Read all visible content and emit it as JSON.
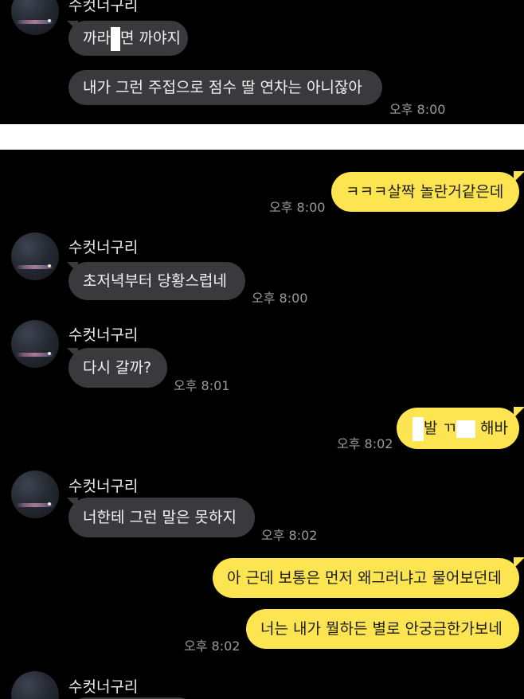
{
  "top_panel": {
    "sender": "수컷너구리",
    "msg1_part1": "까라",
    "msg1_part2": "면 까야지",
    "msg2": "내가 그런 주접으로 점수 딸 연차는 아니잖아",
    "time": "오후 8:00"
  },
  "chat": {
    "msg_out_1": "ㅋㅋㅋ살짝 놀란거같은데",
    "time_out_1": "오후 8:00",
    "sender_2": "수컷너구리",
    "msg_in_2": "초저녁부터 당황스럽네",
    "time_in_2": "오후 8:00",
    "sender_3": "수컷너구리",
    "msg_in_3": "다시 갈까?",
    "time_in_3": "오후 8:01",
    "msg_out_4_part1": "발 ㄲ",
    "msg_out_4_part2": "해바",
    "time_out_4": "오후 8:02",
    "sender_5": "수컷너구리",
    "msg_in_5": "너한테 그런 말은 못하지",
    "time_in_5": "오후 8:02",
    "msg_out_6": "아 근데 보통은 먼저 왜그러냐고 물어보던데",
    "msg_out_7": "너는 내가 뭘하든 별로 안궁금한가보네",
    "time_out_7": "오후 8:02",
    "sender_8": "수컷너구리"
  },
  "colors": {
    "background": "#000000",
    "incoming_bubble": "#3a3a3c",
    "outgoing_bubble": "#fde551",
    "separator": "#ffffff",
    "timestamp": "#9a9a9a"
  }
}
